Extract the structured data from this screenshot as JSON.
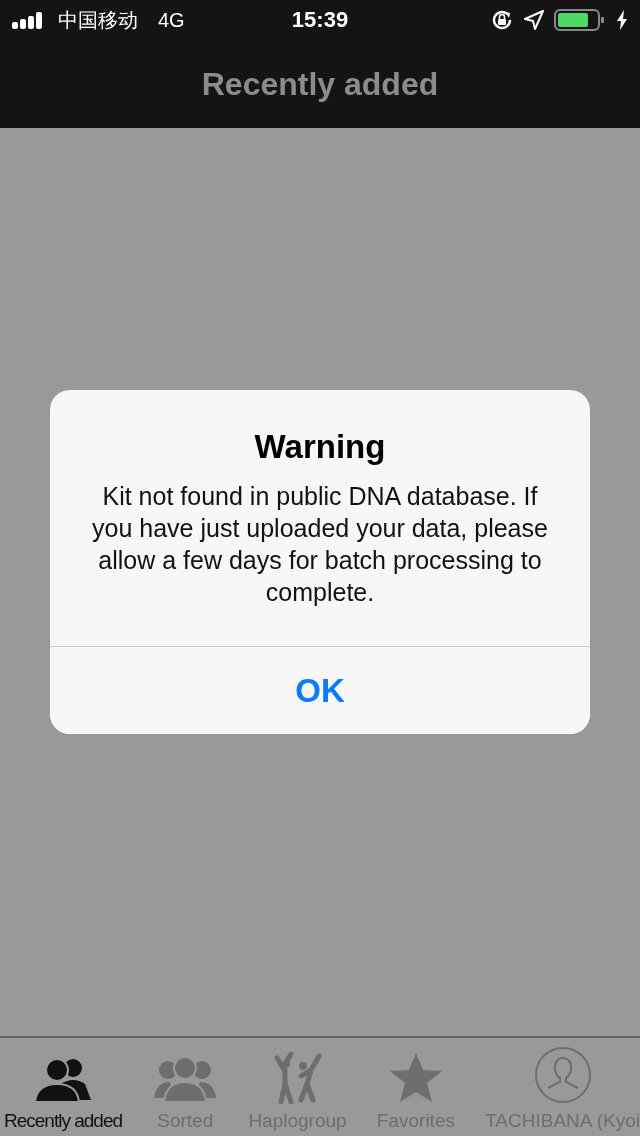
{
  "status_bar": {
    "carrier": "中国移动",
    "network": "4G",
    "time": "15:39"
  },
  "nav_bar": {
    "title": "Recently added"
  },
  "alert": {
    "title": "Warning",
    "message": "Kit not found in public DNA database. If you have just uploaded your data, please allow a few days for batch processing to complete.",
    "button": "OK"
  },
  "tab_bar": {
    "items": [
      {
        "kind": "people",
        "label": "Recently added",
        "selected": true
      },
      {
        "kind": "group",
        "label": "Sorted",
        "selected": false
      },
      {
        "kind": "dancers",
        "label": "Haplogroup",
        "selected": false
      },
      {
        "kind": "star",
        "label": "Favorites",
        "selected": false
      },
      {
        "kind": "avatar",
        "label": "TACHIBANA  (Kyoi",
        "selected": false
      }
    ]
  }
}
